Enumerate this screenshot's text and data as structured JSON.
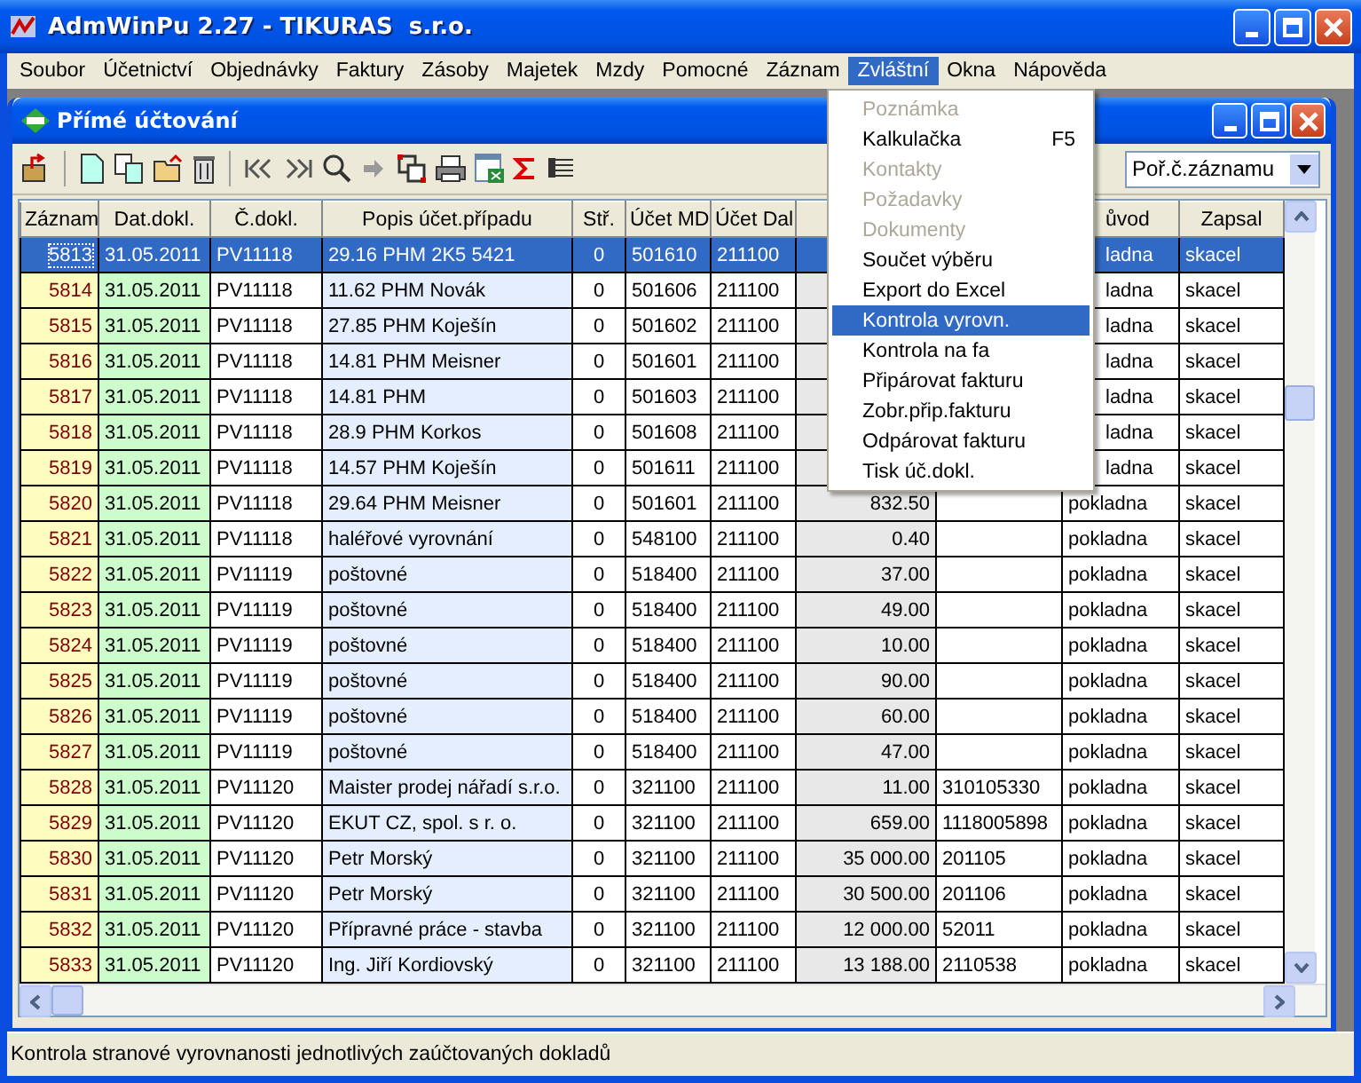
{
  "window": {
    "title": "AdmWinPu 2.27 - TIKURAS  s.r.o."
  },
  "menu": [
    {
      "label": "Soubor",
      "selected": false
    },
    {
      "label": "Účetnictví",
      "selected": false
    },
    {
      "label": "Objednávky",
      "selected": false
    },
    {
      "label": "Faktury",
      "selected": false
    },
    {
      "label": "Zásoby",
      "selected": false
    },
    {
      "label": "Majetek",
      "selected": false
    },
    {
      "label": "Mzdy",
      "selected": false
    },
    {
      "label": "Pomocné",
      "selected": false
    },
    {
      "label": "Záznam",
      "selected": false
    },
    {
      "label": "Zvláštní",
      "selected": true
    },
    {
      "label": "Okna",
      "selected": false
    },
    {
      "label": "Nápověda",
      "selected": false
    }
  ],
  "dropdown": [
    {
      "label": "Poznámka",
      "disabled": true,
      "selected": false
    },
    {
      "label": "Kalkulačka",
      "shortcut": "F5",
      "disabled": false,
      "selected": false
    },
    {
      "label": "Kontakty",
      "disabled": true,
      "selected": false
    },
    {
      "label": "Požadavky",
      "disabled": true,
      "selected": false
    },
    {
      "label": "Dokumenty",
      "disabled": true,
      "selected": false
    },
    {
      "label": "Součet výběru",
      "disabled": false,
      "selected": false
    },
    {
      "label": "Export do Excel",
      "disabled": false,
      "selected": false
    },
    {
      "label": "Kontrola vyrovn.",
      "disabled": false,
      "selected": true
    },
    {
      "label": "Kontrola na fa",
      "disabled": false,
      "selected": false
    },
    {
      "label": "Připárovat fakturu",
      "disabled": false,
      "selected": false
    },
    {
      "label": "Zobr.přip.fakturu",
      "disabled": false,
      "selected": false
    },
    {
      "label": "Odpárovat fakturu",
      "disabled": false,
      "selected": false
    },
    {
      "label": "Tisk úč.dokl.",
      "disabled": false,
      "selected": false
    }
  ],
  "child_window": {
    "title": "Přímé účtování"
  },
  "sort_combo": {
    "value": "Poř.č.záznamu"
  },
  "table": {
    "columns": [
      "Záznam",
      "Dat.dokl.",
      "Č.dokl.",
      "Popis účet.případu",
      "Stř.",
      "Účet MD",
      "Účet Dal",
      "ůvod",
      "Zapsal"
    ],
    "rows": [
      {
        "record": "5813",
        "date": "31.05.2011",
        "doc": "PV11118",
        "desc": "29.16 PHM 2K5 5421",
        "center": "0",
        "md": "501610",
        "dal": "211100",
        "source": "ladna",
        "user": "skacel",
        "selected": true
      },
      {
        "record": "5814",
        "date": "31.05.2011",
        "doc": "PV11118",
        "desc": "11.62 PHM Novák",
        "center": "0",
        "md": "501606",
        "dal": "211100",
        "source": "ladna",
        "user": "skacel",
        "selected": false
      },
      {
        "record": "5815",
        "date": "31.05.2011",
        "doc": "PV11118",
        "desc": "27.85 PHM Koješín",
        "center": "0",
        "md": "501602",
        "dal": "211100",
        "source": "ladna",
        "user": "skacel",
        "selected": false
      },
      {
        "record": "5816",
        "date": "31.05.2011",
        "doc": "PV11118",
        "desc": "14.81 PHM Meisner",
        "center": "0",
        "md": "501601",
        "dal": "211100",
        "source": "ladna",
        "user": "skacel",
        "selected": false
      },
      {
        "record": "5817",
        "date": "31.05.2011",
        "doc": "PV11118",
        "desc": "14.81 PHM",
        "center": "0",
        "md": "501603",
        "dal": "211100",
        "source": "ladna",
        "user": "skacel",
        "selected": false
      },
      {
        "record": "5818",
        "date": "31.05.2011",
        "doc": "PV11118",
        "desc": "28.9 PHM Korkos",
        "center": "0",
        "md": "501608",
        "dal": "211100",
        "source": "ladna",
        "user": "skacel",
        "selected": false
      },
      {
        "record": "5819",
        "date": "31.05.2011",
        "doc": "PV11118",
        "desc": "14.57 PHM Koješín",
        "center": "0",
        "md": "501611",
        "dal": "211100",
        "source": "ladna",
        "user": "skacel",
        "selected": false
      },
      {
        "record": "5820",
        "date": "31.05.2011",
        "doc": "PV11118",
        "desc": "29.64 PHM Meisner",
        "center": "0",
        "md": "501601",
        "dal": "211100",
        "amount": "832.50",
        "source": "pokladna",
        "user": "skacel",
        "selected": false
      },
      {
        "record": "5821",
        "date": "31.05.2011",
        "doc": "PV11118",
        "desc": "haléřové vyrovnání",
        "center": "0",
        "md": "548100",
        "dal": "211100",
        "amount": "0.40",
        "source": "pokladna",
        "user": "skacel",
        "selected": false
      },
      {
        "record": "5822",
        "date": "31.05.2011",
        "doc": "PV11119",
        "desc": "poštovné",
        "center": "0",
        "md": "518400",
        "dal": "211100",
        "amount": "37.00",
        "source": "pokladna",
        "user": "skacel",
        "selected": false
      },
      {
        "record": "5823",
        "date": "31.05.2011",
        "doc": "PV11119",
        "desc": "poštovné",
        "center": "0",
        "md": "518400",
        "dal": "211100",
        "amount": "49.00",
        "source": "pokladna",
        "user": "skacel",
        "selected": false
      },
      {
        "record": "5824",
        "date": "31.05.2011",
        "doc": "PV11119",
        "desc": "poštovné",
        "center": "0",
        "md": "518400",
        "dal": "211100",
        "amount": "10.00",
        "source": "pokladna",
        "user": "skacel",
        "selected": false
      },
      {
        "record": "5825",
        "date": "31.05.2011",
        "doc": "PV11119",
        "desc": "poštovné",
        "center": "0",
        "md": "518400",
        "dal": "211100",
        "amount": "90.00",
        "source": "pokladna",
        "user": "skacel",
        "selected": false
      },
      {
        "record": "5826",
        "date": "31.05.2011",
        "doc": "PV11119",
        "desc": "poštovné",
        "center": "0",
        "md": "518400",
        "dal": "211100",
        "amount": "60.00",
        "source": "pokladna",
        "user": "skacel",
        "selected": false
      },
      {
        "record": "5827",
        "date": "31.05.2011",
        "doc": "PV11119",
        "desc": "poštovné",
        "center": "0",
        "md": "518400",
        "dal": "211100",
        "amount": "47.00",
        "source": "pokladna",
        "user": "skacel",
        "selected": false
      },
      {
        "record": "5828",
        "date": "31.05.2011",
        "doc": "PV11120",
        "desc": "Maister prodej nářadí s.r.o.",
        "center": "0",
        "md": "321100",
        "dal": "211100",
        "amount": "11.00",
        "ref": "310105330",
        "source": "pokladna",
        "user": "skacel",
        "selected": false
      },
      {
        "record": "5829",
        "date": "31.05.2011",
        "doc": "PV11120",
        "desc": "EKUT CZ, spol. s r. o.",
        "center": "0",
        "md": "321100",
        "dal": "211100",
        "amount": "659.00",
        "ref": "1118005898",
        "source": "pokladna",
        "user": "skacel",
        "selected": false
      },
      {
        "record": "5830",
        "date": "31.05.2011",
        "doc": "PV11120",
        "desc": "Petr Morský",
        "center": "0",
        "md": "321100",
        "dal": "211100",
        "amount": "35 000.00",
        "ref": "201105",
        "source": "pokladna",
        "user": "skacel",
        "selected": false
      },
      {
        "record": "5831",
        "date": "31.05.2011",
        "doc": "PV11120",
        "desc": "Petr Morský",
        "center": "0",
        "md": "321100",
        "dal": "211100",
        "amount": "30 500.00",
        "ref": "201106",
        "source": "pokladna",
        "user": "skacel",
        "selected": false
      },
      {
        "record": "5832",
        "date": "31.05.2011",
        "doc": "PV11120",
        "desc": "Přípravné práce - stavba",
        "center": "0",
        "md": "321100",
        "dal": "211100",
        "amount": "12 000.00",
        "ref": "52011",
        "source": "pokladna",
        "user": "skacel",
        "selected": false
      },
      {
        "record": "5833",
        "date": "31.05.2011",
        "doc": "PV11120",
        "desc": "Ing. Jiří Kordiovský",
        "center": "0",
        "md": "321100",
        "dal": "211100",
        "amount": "13 188.00",
        "ref": "2110538",
        "source": "pokladna",
        "user": "skacel",
        "selected": false
      }
    ]
  },
  "status_bar": "Kontrola stranové vyrovnanosti jednotlivých zaúčtovaných dokladů"
}
